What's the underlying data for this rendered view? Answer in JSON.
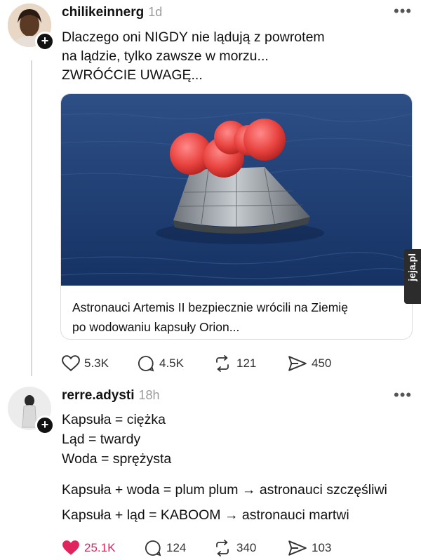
{
  "post1": {
    "username": "chilikeinnerg",
    "time": "1d",
    "more": "•••",
    "lines": [
      "Dlaczego oni NIGDY nie lądują z powrotem",
      "na lądzie, tylko zawsze w morzu...",
      "ZWRÓĆCIE UWAGĘ..."
    ],
    "card_caption_lines": [
      "Astronauci Artemis II bezpiecznie wrócili na Ziemię",
      "po wodowaniu kapsuły Orion..."
    ],
    "actions": {
      "likes": "5.3K",
      "comments": "4.5K",
      "reposts": "121",
      "shares": "450"
    }
  },
  "post2": {
    "username": "rerre.adysti",
    "time": "18h",
    "more": "•••",
    "lines": [
      "Kapsuła = ciężka",
      "Ląd = twardy",
      "Woda = sprężysta",
      "Kapsuła + woda = plum plum → astronauci szczęśliwi",
      "Kapsuła + ląd = KABOOM → astronauci martwi"
    ],
    "actions": {
      "likes": "25.1K",
      "comments": "124",
      "reposts": "340",
      "shares": "103"
    }
  },
  "watermark": "jeja.pl",
  "colors": {
    "liked": "#e0245e",
    "muted": "#9a9a9a",
    "sea": "#1f3f72"
  }
}
